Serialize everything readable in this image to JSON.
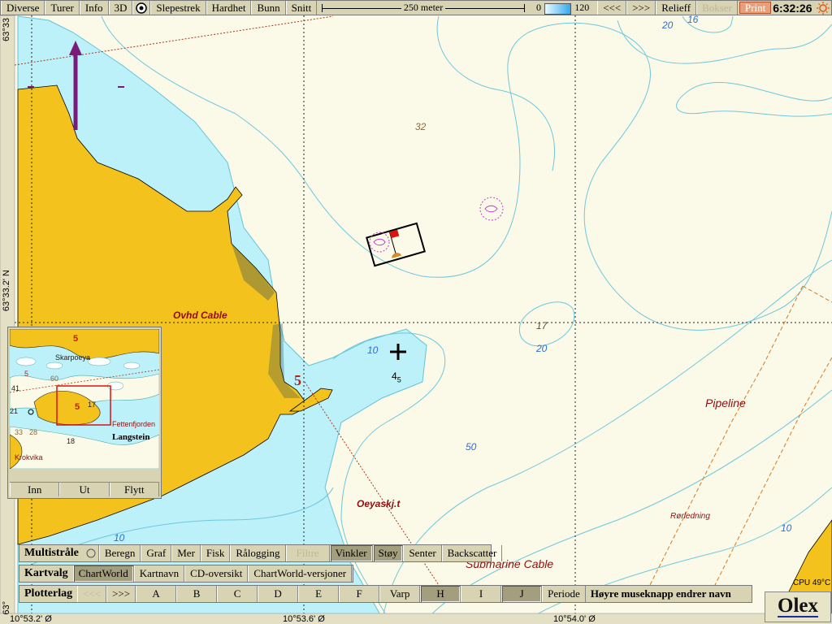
{
  "top_bar": {
    "buttons": [
      "Diverse",
      "Turer",
      "Info",
      "3D"
    ],
    "buttons2": [
      "Slepestrek",
      "Hardhet",
      "Bunn",
      "Snitt"
    ],
    "scale_label": "250 meter",
    "depth_min": "0",
    "depth_max": "120",
    "nav_prev": "<<<",
    "nav_next": ">>>",
    "relieff": "Relieff",
    "bokser": "Bokser",
    "print": "Print",
    "clock": "6:32:26",
    "icons": {
      "target": "target-icon",
      "sun": "sun-icon"
    }
  },
  "coords": {
    "lat_top": "63°33",
    "lat_mid": "63°33.2' N",
    "lat_bottom": "63°",
    "lon_left": "10°53.2' Ø",
    "lon_mid": "10°53.6' Ø",
    "lon_right": "10°54.0' Ø"
  },
  "map_labels": {
    "depth_32": "32",
    "depth_17": "17",
    "depth_20_top": "20",
    "depth_16": "16",
    "depth_20_mid": "20",
    "depth_10_mid": "10",
    "depth_4": "4",
    "depth_4_sub": "5",
    "depth_50": "50",
    "depth_10_left": "10",
    "depth_10_right": "10",
    "ovhd_cable": "Ovhd Cable",
    "marker_5": "5",
    "pipeline": "Pipeline",
    "oeyaskjt": "Oeyaskj.t",
    "roerledning": "Rørledning",
    "submarine_cable": "Submarine Cable"
  },
  "inset": {
    "labels": {
      "skarpoeya": "Skarpoeya",
      "fettenfjorden": "Fettenfjorden",
      "langstein": "Langstein",
      "krokvika": "Krokvika",
      "n41": "41",
      "n21": "21",
      "n60": "60",
      "n33": "33",
      "n28": "28",
      "n18": "18",
      "n5": "5",
      "n17": "17",
      "n5b": "5",
      "n5c": "5"
    },
    "buttons": [
      "Inn",
      "Ut",
      "Flytt"
    ]
  },
  "multistraale": {
    "label": "Multistråle",
    "buttons": [
      "Beregn",
      "Graf",
      "Mer",
      "Fisk",
      "Rålogging",
      "Filtre",
      "Vinkler",
      "Støy",
      "Senter",
      "Backscatter"
    ],
    "states": [
      "normal",
      "normal",
      "normal",
      "normal",
      "normal",
      "disabled",
      "active",
      "active",
      "normal",
      "normal"
    ]
  },
  "kartvalg": {
    "label": "Kartvalg",
    "buttons": [
      "ChartWorld",
      "Kartnavn",
      "CD-oversikt",
      "ChartWorld-versjoner"
    ],
    "states": [
      "active",
      "normal",
      "normal",
      "normal"
    ]
  },
  "plotterlag": {
    "label": "Plotterlag",
    "buttons": [
      "<<<",
      ">>>",
      "A",
      "B",
      "C",
      "D",
      "E",
      "F",
      "Varp",
      "H",
      "I",
      "J",
      "Periode"
    ],
    "states": [
      "disabled",
      "normal",
      "normal",
      "normal",
      "normal",
      "normal",
      "normal",
      "normal",
      "normal",
      "active",
      "normal",
      "active",
      "normal"
    ],
    "hint": "Høyre museknapp endrer navn"
  },
  "status": {
    "cpu": "CPU 49°C",
    "logo": "Olex"
  },
  "colors": {
    "land": "#f3c21c",
    "shallow": "#b8f0f8",
    "sea": "#fbf9e8",
    "contour": "#5bbfd6",
    "toolbar": "#d8d3b2",
    "red_line": "#b0331c",
    "marker_purple": "#7a1a7a"
  }
}
